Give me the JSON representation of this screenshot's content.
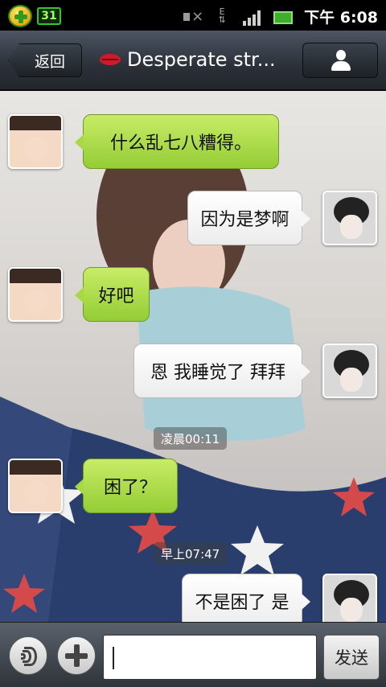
{
  "status_bar": {
    "badge_text": "31",
    "clock": "下午 6:08"
  },
  "title_bar": {
    "back_label": "返回",
    "title": "Desperate str...",
    "title_icon": "lips-icon",
    "profile_icon": "person-icon"
  },
  "messages": [
    {
      "side": "left",
      "text": "什么乱七八糟得。"
    },
    {
      "side": "right",
      "text": "因为是梦啊"
    },
    {
      "side": "left",
      "text": "好吧"
    },
    {
      "side": "right",
      "text": "恩  我睡觉了 拜拜"
    },
    {
      "side": "left",
      "text": "困了？"
    },
    {
      "side": "right",
      "text": "不是困了 是"
    }
  ],
  "timestamps": [
    "凌晨00:11",
    "早上07:47"
  ],
  "composer": {
    "voice_icon": "voice-icon",
    "plus_icon": "plus-icon",
    "send_label": "发送",
    "input_value": ""
  },
  "colors": {
    "received_bubble": "#a8d844",
    "sent_bubble": "#ffffff",
    "title_bar": "#2c3139"
  }
}
